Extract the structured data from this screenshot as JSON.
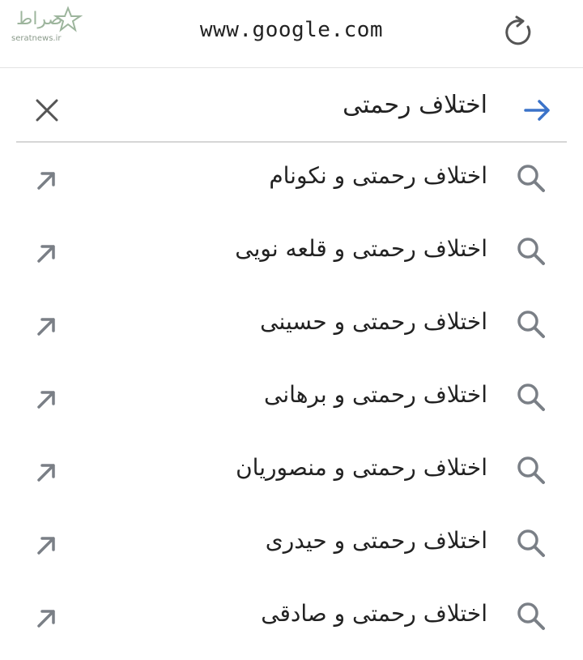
{
  "watermark": {
    "logo_text": "صراط",
    "site": "seratnews.ir"
  },
  "address_bar": {
    "url": "www.google.com"
  },
  "search": {
    "query": "اختلاف رحمتی"
  },
  "suggestions": [
    {
      "label": "اختلاف رحمتی و نکونام"
    },
    {
      "label": "اختلاف رحمتی و قلعه نویی"
    },
    {
      "label": "اختلاف رحمتی و حسینی"
    },
    {
      "label": "اختلاف رحمتی و برهانی"
    },
    {
      "label": "اختلاف رحمتی و منصوریان"
    },
    {
      "label": "اختلاف رحمتی و حیدری"
    },
    {
      "label": "اختلاف رحمتی و صادقی"
    }
  ],
  "colors": {
    "accent": "#3b73c9",
    "icon_gray": "#7a7f86",
    "text": "#222222"
  }
}
